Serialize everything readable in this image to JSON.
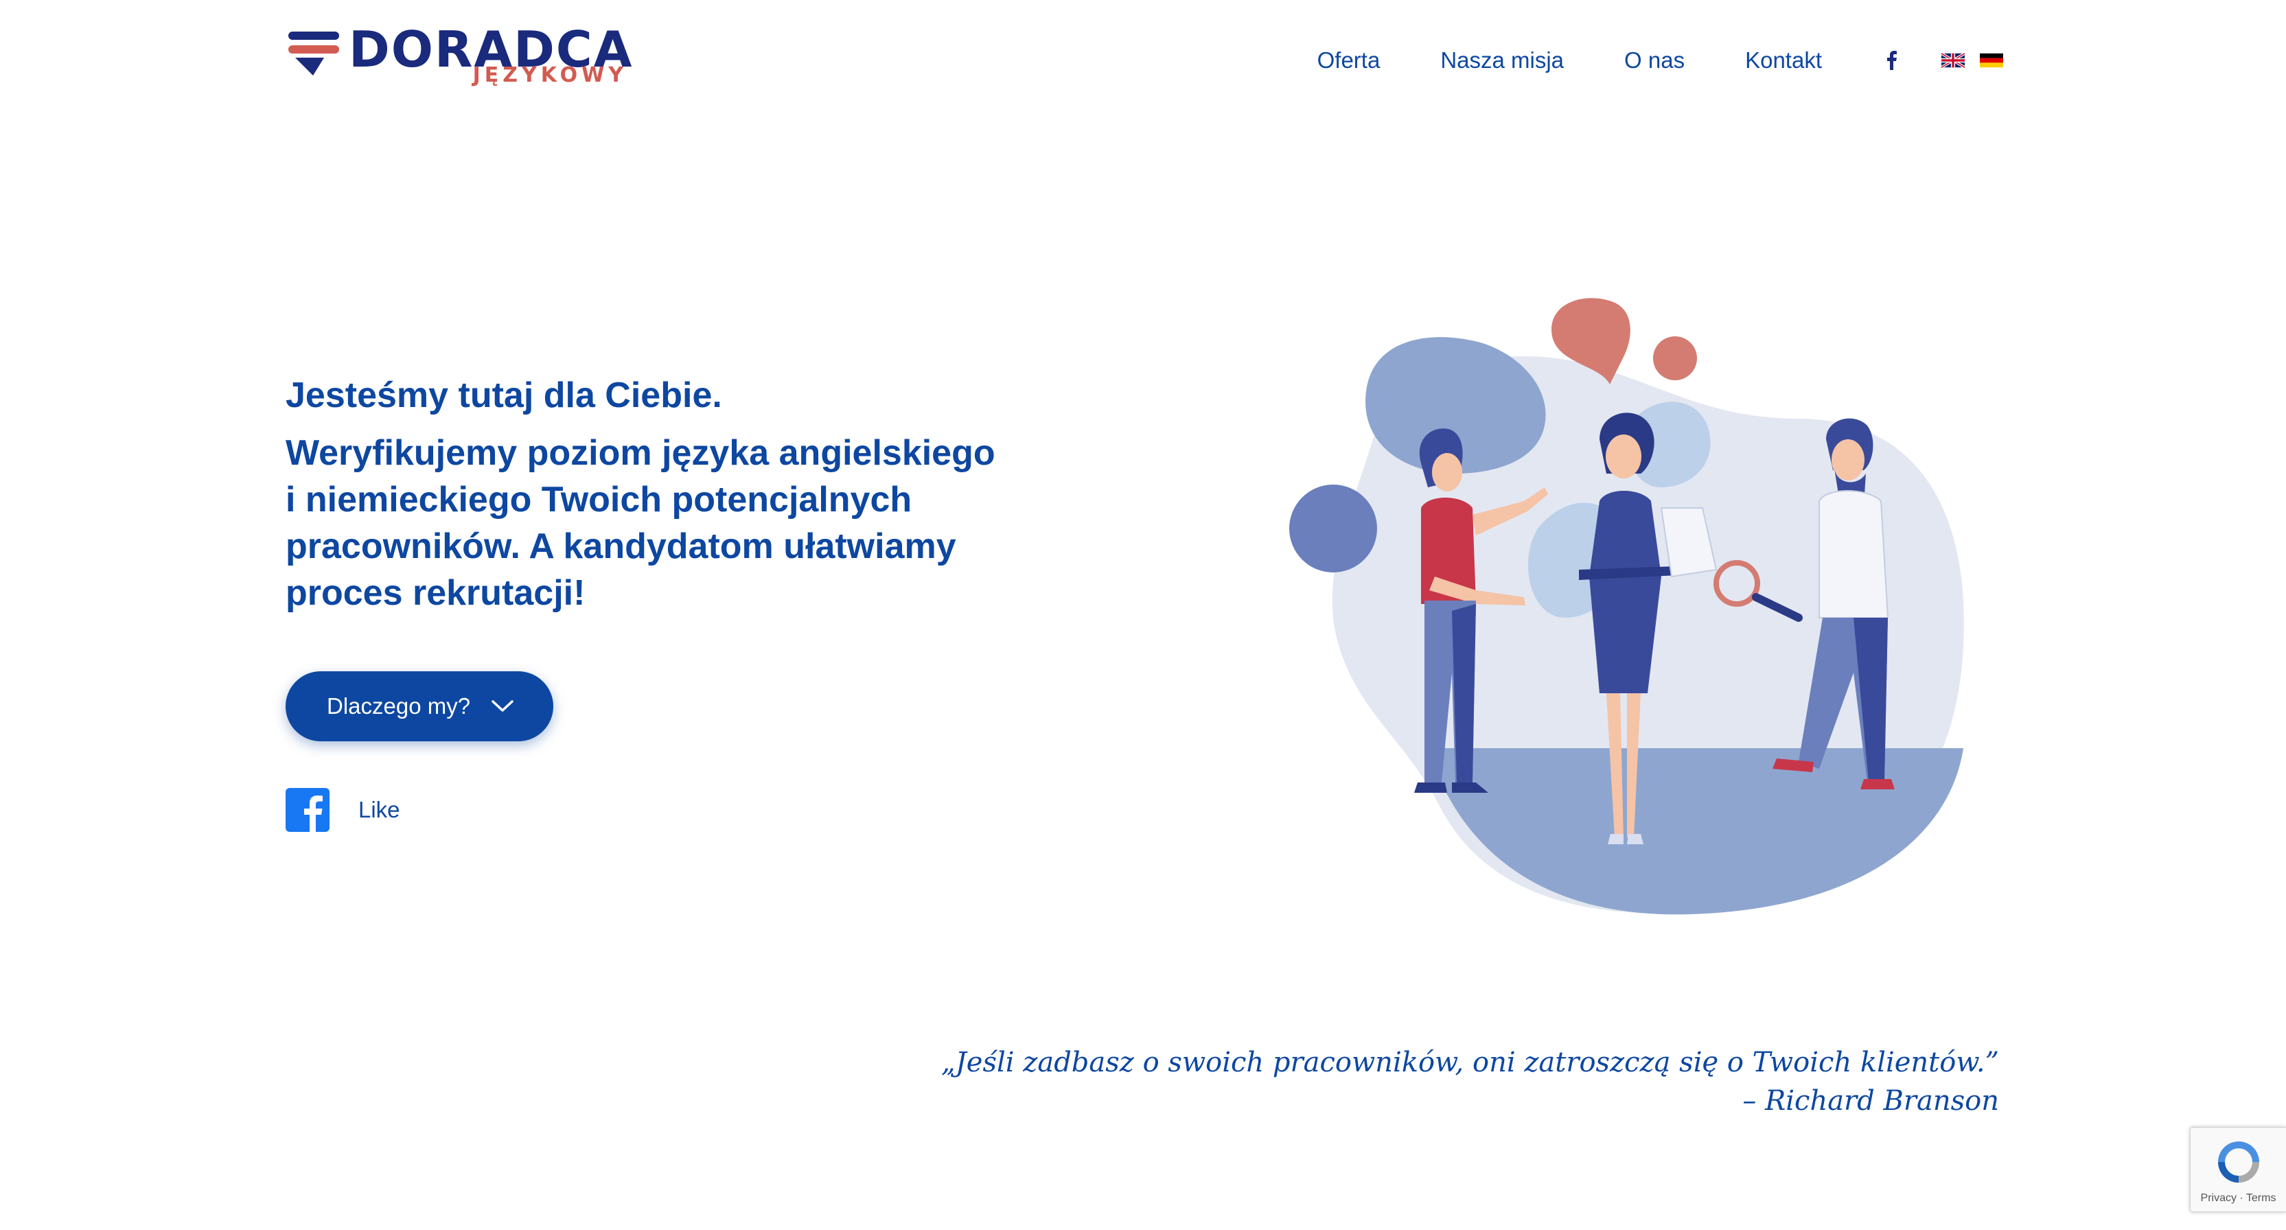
{
  "header": {
    "logo": {
      "word": "DORADCA",
      "sub": "JĘZYKOWY"
    },
    "nav": [
      "Oferta",
      "Nasza misja",
      "O nas",
      "Kontakt"
    ],
    "languages": [
      "en",
      "de"
    ]
  },
  "hero": {
    "subtitle": "Jesteśmy tutaj dla Ciebie.",
    "title_lines": [
      "Weryfikujemy poziom języka angielskiego",
      "i niemieckiego Twoich potencjalnych",
      "pracowników. A kandydatom ułatwiamy",
      "proces rekrutacji!"
    ],
    "cta_label": "Dlaczego my?",
    "like_label": "Like"
  },
  "quote": {
    "text": "„Jeśli zadbasz o swoich pracowników, oni zatroszczą się o Twoich klientów.”",
    "author": "– Richard Branson"
  },
  "recaptcha": {
    "privacy": "Privacy",
    "terms": "Terms"
  },
  "colors": {
    "primary": "#0d47a1",
    "logo_navy": "#1a2a7c",
    "logo_red": "#d25b52",
    "illustration_blue": "#8ea6cf",
    "illustration_light": "#e3e7f1"
  },
  "icons": [
    "logo-mark",
    "facebook-icon",
    "uk-flag-icon",
    "germany-flag-icon",
    "chevron-down-icon",
    "recaptcha-icon"
  ]
}
